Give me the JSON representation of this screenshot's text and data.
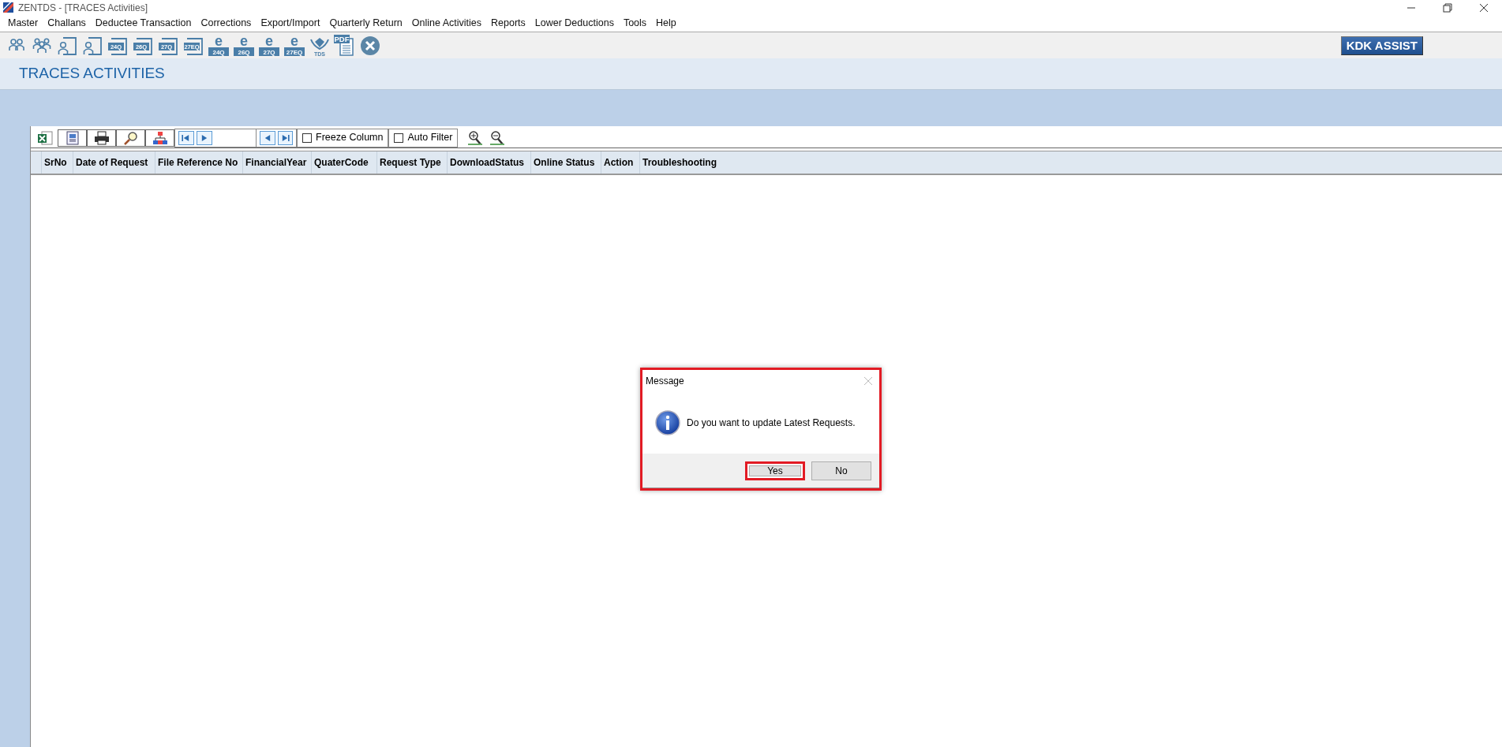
{
  "window": {
    "title": "ZENTDS - [TRACES Activities]"
  },
  "menu": [
    "Master",
    "Challans",
    "Deductee Transaction",
    "Corrections",
    "Export/Import",
    "Quarterly Return",
    "Online Activities",
    "Reports",
    "Lower Deductions",
    "Tools",
    "Help"
  ],
  "toolbar": [
    {
      "kind": "person"
    },
    {
      "kind": "group"
    },
    {
      "kind": "person-frame"
    },
    {
      "kind": "person-frame"
    },
    {
      "kind": "form",
      "label": "24Q"
    },
    {
      "kind": "form",
      "label": "26Q"
    },
    {
      "kind": "form",
      "label": "27Q"
    },
    {
      "kind": "form",
      "label": "27EQ"
    },
    {
      "kind": "eform",
      "letter": "e",
      "label": "24Q"
    },
    {
      "kind": "eform",
      "letter": "e",
      "label": "26Q"
    },
    {
      "kind": "eform",
      "letter": "e",
      "label": "27Q"
    },
    {
      "kind": "eform",
      "letter": "e",
      "label": "27EQ"
    },
    {
      "kind": "tds",
      "label": "TDS"
    },
    {
      "kind": "pdf",
      "label": "PDF"
    },
    {
      "kind": "close"
    }
  ],
  "assist_button": "KDK ASSIST",
  "page_title": "TRACES ACTIVITIES",
  "grid_toolbar": {
    "buttons": [
      {
        "kind": "excel"
      },
      {
        "kind": "word"
      },
      {
        "kind": "print"
      },
      {
        "kind": "find"
      },
      {
        "kind": "tree"
      }
    ],
    "nav_left": [
      {
        "kind": "first"
      },
      {
        "kind": "next"
      }
    ],
    "nav_right": [
      {
        "kind": "prev"
      },
      {
        "kind": "last"
      }
    ],
    "checkboxes": [
      {
        "label": "Freeze Column",
        "checked": false
      },
      {
        "label": "Auto Filter",
        "checked": false
      }
    ],
    "zoom": [
      {
        "kind": "zoom-in"
      },
      {
        "kind": "zoom-out"
      }
    ]
  },
  "table": {
    "columns": [
      "SrNo",
      "Date of Request",
      "File Reference No",
      "FinancialYear",
      "QuaterCode",
      "Request Type",
      "DownloadStatus",
      "Online Status",
      "Action",
      "Troubleshooting"
    ]
  },
  "dialog": {
    "title": "Message",
    "message": "Do you want to update Latest Requests.",
    "highlighted": true,
    "buttons": [
      {
        "label": "Yes",
        "highlighted": true
      },
      {
        "label": "No",
        "highlighted": false
      }
    ]
  }
}
